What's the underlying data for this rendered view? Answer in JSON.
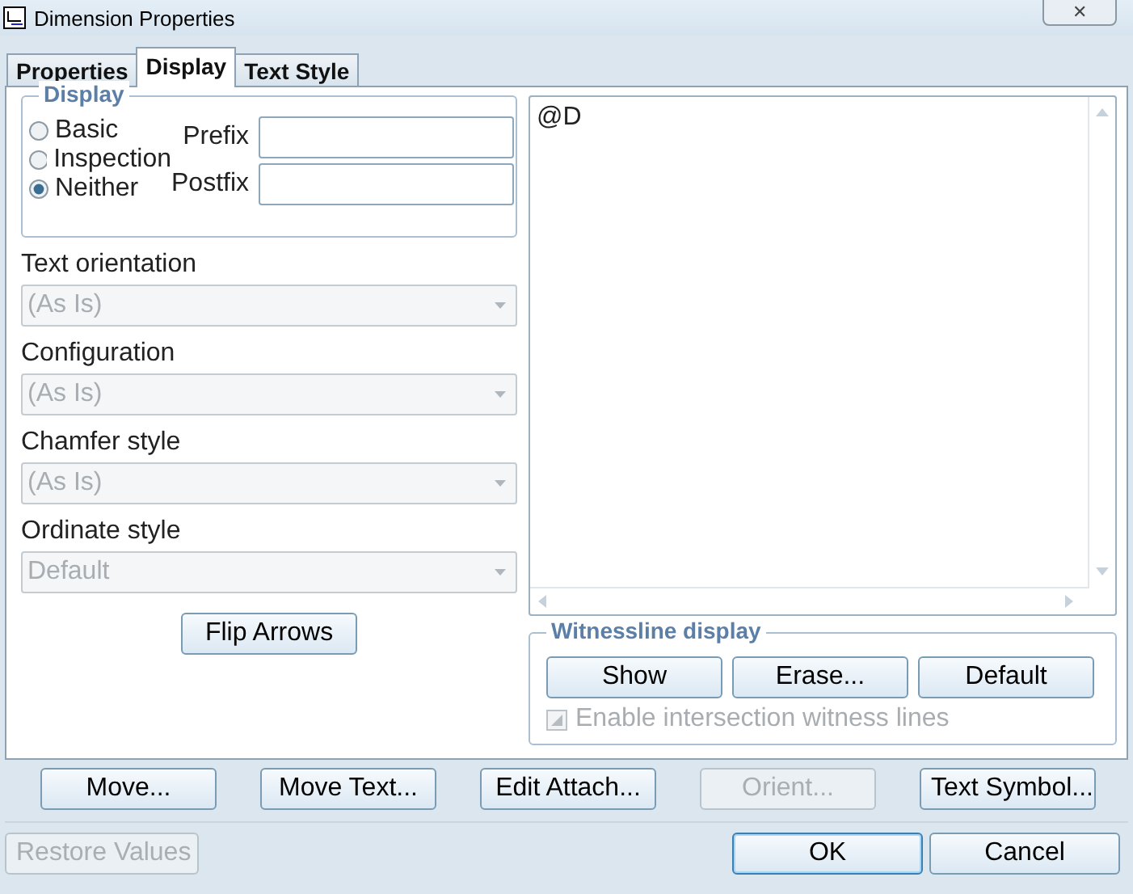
{
  "window": {
    "title": "Dimension Properties",
    "close": "✕"
  },
  "tabs": [
    {
      "label": "Properties",
      "selected": false
    },
    {
      "label": "Display",
      "selected": true
    },
    {
      "label": "Text Style",
      "selected": false
    }
  ],
  "display_group": {
    "title": "Display",
    "options": [
      {
        "label": "Basic",
        "selected": false
      },
      {
        "label": "Inspection",
        "selected": false
      },
      {
        "label": "Neither",
        "selected": true
      }
    ],
    "fields": [
      {
        "label": "Prefix"
      },
      {
        "label": "Postfix"
      }
    ]
  },
  "dropdowns": [
    {
      "label": "Text orientation",
      "value": "(As Is)",
      "disabled": true
    },
    {
      "label": "Configuration",
      "value": "(As Is)",
      "disabled": true
    },
    {
      "label": "Chamfer style",
      "value": "(As Is)",
      "disabled": true
    },
    {
      "label": "Ordinate style",
      "value": "Default",
      "disabled": true
    }
  ],
  "flip_button": {
    "label": "Flip Arrows",
    "disabled": false
  },
  "text_area": {
    "value": "@D"
  },
  "witnessline": {
    "title": "Witnessline display",
    "buttons": [
      {
        "label": "Show",
        "disabled": false
      },
      {
        "label": "Erase...",
        "disabled": false
      },
      {
        "label": "Default",
        "disabled": false
      }
    ],
    "checkbox": {
      "label": "Enable intersection witness lines",
      "checked": true,
      "disabled": true
    }
  },
  "action_buttons": [
    {
      "label": "Move...",
      "disabled": false
    },
    {
      "label": "Move Text...",
      "disabled": false
    },
    {
      "label": "Edit Attach...",
      "disabled": false
    },
    {
      "label": "Orient...",
      "disabled": true
    },
    {
      "label": "Text Symbol...",
      "disabled": false
    }
  ],
  "footer": {
    "restore": {
      "label": "Restore Values",
      "disabled": true
    },
    "ok": {
      "label": "OK",
      "disabled": false,
      "default": true
    },
    "cancel": {
      "label": "Cancel",
      "disabled": false
    }
  }
}
